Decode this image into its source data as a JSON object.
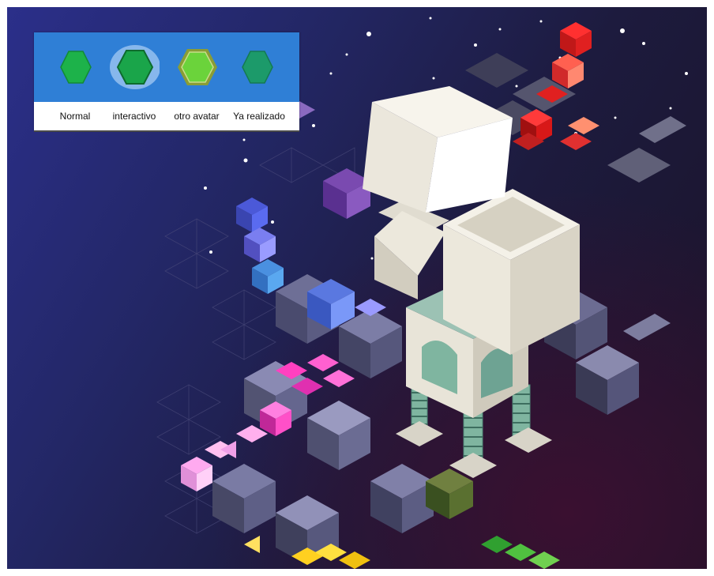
{
  "legend": {
    "items": [
      {
        "label": "Normal",
        "state": "normal",
        "fill": "#1db24a",
        "stroke": "#138a35"
      },
      {
        "label": "interactivo",
        "state": "interactive",
        "fill": "#1aa54a",
        "stroke": "#138a35"
      },
      {
        "label": "otro avatar",
        "state": "other-avatar",
        "fill": "#6bd33b",
        "stroke": "#8a9d35"
      },
      {
        "label": "Ya realizado",
        "state": "done",
        "fill": "#1c9a6a",
        "stroke": "#157a52"
      }
    ],
    "band_color": "#2f7fd6"
  },
  "scene": {
    "character": "robot-avatar",
    "background_color": "#232766"
  }
}
